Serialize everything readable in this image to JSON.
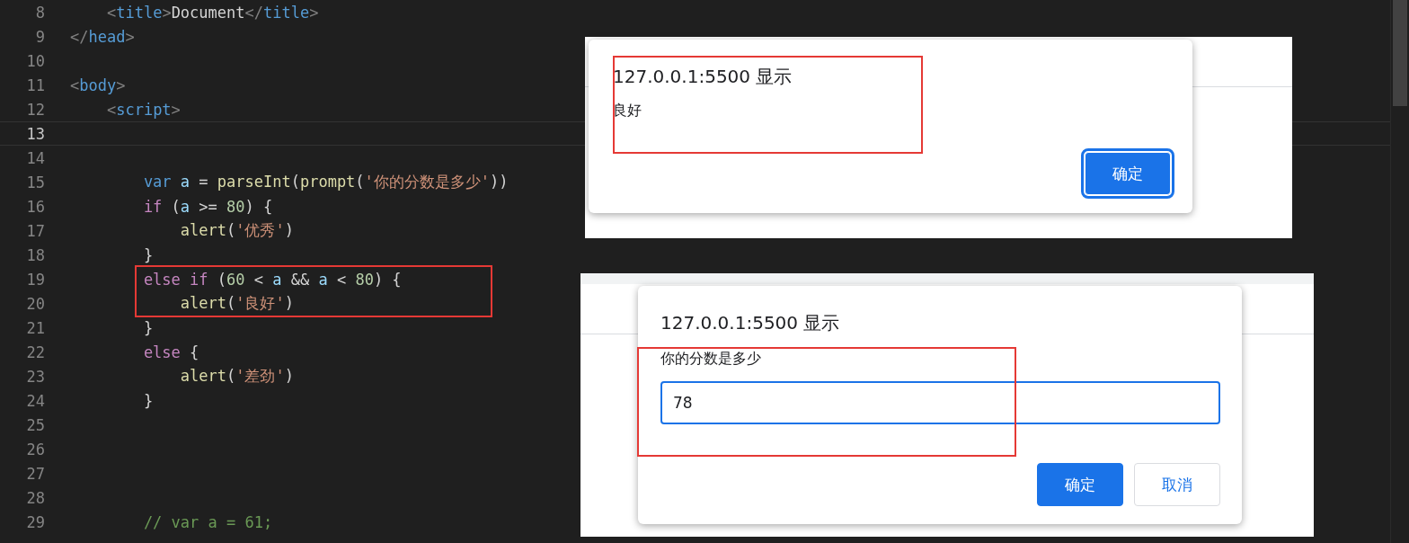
{
  "editor": {
    "lines": [
      {
        "number": "8",
        "current": false,
        "boxed": false,
        "tokens": [
          {
            "kind": "punct",
            "text": "    <"
          },
          {
            "kind": "tag",
            "text": "title"
          },
          {
            "kind": "punct",
            "text": ">"
          },
          {
            "kind": "text",
            "text": "Document"
          },
          {
            "kind": "punct",
            "text": "</"
          },
          {
            "kind": "tag",
            "text": "title"
          },
          {
            "kind": "punct",
            "text": ">"
          }
        ]
      },
      {
        "number": "9",
        "current": false,
        "boxed": false,
        "tokens": [
          {
            "kind": "punct",
            "text": "</"
          },
          {
            "kind": "tag",
            "text": "head"
          },
          {
            "kind": "punct",
            "text": ">"
          }
        ]
      },
      {
        "number": "10",
        "current": false,
        "boxed": false
      },
      {
        "number": "11",
        "current": false,
        "boxed": false,
        "tokens": [
          {
            "kind": "punct",
            "text": "<"
          },
          {
            "kind": "tag",
            "text": "body"
          },
          {
            "kind": "punct",
            "text": ">"
          }
        ]
      },
      {
        "number": "12",
        "current": false,
        "boxed": false,
        "tokens": [
          {
            "kind": "punct",
            "text": "    <"
          },
          {
            "kind": "tag",
            "text": "script"
          },
          {
            "kind": "punct",
            "text": ">"
          }
        ]
      },
      {
        "number": "13",
        "current": true,
        "boxed": false
      },
      {
        "number": "14",
        "current": false,
        "boxed": false
      },
      {
        "number": "15",
        "current": false,
        "boxed": false,
        "tokens": [
          {
            "kind": "storage",
            "text": "        var "
          },
          {
            "kind": "variable",
            "text": "a"
          },
          {
            "kind": "text",
            "text": " = "
          },
          {
            "kind": "function",
            "text": "parseInt"
          },
          {
            "kind": "text",
            "text": "("
          },
          {
            "kind": "function",
            "text": "prompt"
          },
          {
            "kind": "text",
            "text": "("
          },
          {
            "kind": "string",
            "text": "'你的分数是多少'"
          },
          {
            "kind": "text",
            "text": "))"
          }
        ]
      },
      {
        "number": "16",
        "current": false,
        "boxed": false,
        "tokens": [
          {
            "kind": "keyword",
            "text": "        if"
          },
          {
            "kind": "text",
            "text": " ("
          },
          {
            "kind": "variable",
            "text": "a"
          },
          {
            "kind": "text",
            "text": " >= "
          },
          {
            "kind": "number",
            "text": "80"
          },
          {
            "kind": "text",
            "text": ") {"
          }
        ]
      },
      {
        "number": "17",
        "current": false,
        "boxed": false,
        "tokens": [
          {
            "kind": "function",
            "text": "            alert"
          },
          {
            "kind": "text",
            "text": "("
          },
          {
            "kind": "string",
            "text": "'优秀'"
          },
          {
            "kind": "text",
            "text": ")"
          }
        ]
      },
      {
        "number": "18",
        "current": false,
        "boxed": false,
        "tokens": [
          {
            "kind": "text",
            "text": "        }"
          }
        ]
      },
      {
        "number": "19",
        "current": false,
        "boxed": true,
        "tokens": [
          {
            "kind": "keyword",
            "text": "        else if"
          },
          {
            "kind": "text",
            "text": " ("
          },
          {
            "kind": "number",
            "text": "60"
          },
          {
            "kind": "text",
            "text": " < "
          },
          {
            "kind": "variable",
            "text": "a"
          },
          {
            "kind": "text",
            "text": " && "
          },
          {
            "kind": "variable",
            "text": "a"
          },
          {
            "kind": "text",
            "text": " < "
          },
          {
            "kind": "number",
            "text": "80"
          },
          {
            "kind": "text",
            "text": ") {"
          }
        ]
      },
      {
        "number": "20",
        "current": false,
        "boxed": true,
        "tokens": [
          {
            "kind": "function",
            "text": "            alert"
          },
          {
            "kind": "text",
            "text": "("
          },
          {
            "kind": "string",
            "text": "'良好'"
          },
          {
            "kind": "text",
            "text": ")"
          }
        ]
      },
      {
        "number": "21",
        "current": false,
        "boxed": false,
        "tokens": [
          {
            "kind": "text",
            "text": "        }"
          }
        ]
      },
      {
        "number": "22",
        "current": false,
        "boxed": false,
        "tokens": [
          {
            "kind": "keyword",
            "text": "        else"
          },
          {
            "kind": "text",
            "text": " {"
          }
        ]
      },
      {
        "number": "23",
        "current": false,
        "boxed": false,
        "tokens": [
          {
            "kind": "function",
            "text": "            alert"
          },
          {
            "kind": "text",
            "text": "("
          },
          {
            "kind": "string",
            "text": "'差劲'"
          },
          {
            "kind": "text",
            "text": ")"
          }
        ]
      },
      {
        "number": "24",
        "current": false,
        "boxed": false,
        "tokens": [
          {
            "kind": "text",
            "text": "        }"
          }
        ]
      },
      {
        "number": "25",
        "current": false,
        "boxed": false
      },
      {
        "number": "26",
        "current": false,
        "boxed": false
      },
      {
        "number": "27",
        "current": false,
        "boxed": false
      },
      {
        "number": "28",
        "current": false,
        "boxed": false
      },
      {
        "number": "29",
        "current": false,
        "boxed": false,
        "tokens": [
          {
            "kind": "comment",
            "text": "        // var a = 61;"
          }
        ]
      }
    ]
  },
  "dialogs": [
    {
      "kind": "alert",
      "annotated": true,
      "title": "127.0.0.1:5500 显示",
      "message": "良好",
      "buttons": [
        {
          "kind": "primary",
          "label": "确定",
          "focused": true
        }
      ]
    },
    {
      "kind": "prompt",
      "annotated": true,
      "title": "127.0.0.1:5500 显示",
      "message": "你的分数是多少",
      "value": "78",
      "buttons": [
        {
          "kind": "primary",
          "label": "确定",
          "focused": false
        },
        {
          "kind": "secondary",
          "label": "取消",
          "focused": false
        }
      ]
    }
  ]
}
